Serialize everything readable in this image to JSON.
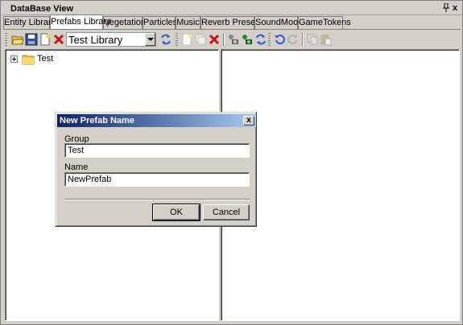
{
  "window": {
    "title": "DataBase View",
    "pin_icon": "pin-icon",
    "close_glyph": "x"
  },
  "tabs": [
    {
      "label": "Entity Library",
      "active": false
    },
    {
      "label": "Prefabs Library",
      "active": true
    },
    {
      "label": "Vegetation",
      "active": false
    },
    {
      "label": "Particles",
      "active": false
    },
    {
      "label": "Music",
      "active": false
    },
    {
      "label": "Reverb Presets",
      "active": false
    },
    {
      "label": "SoundMoods",
      "active": false
    },
    {
      "label": "GameTokens",
      "active": false
    }
  ],
  "toolbar": {
    "library_select": "Test Library",
    "icons": [
      "open-icon",
      "save-icon",
      "new-library-icon",
      "delete-library-icon",
      "reload-icon",
      "add-item-icon",
      "clone-icon",
      "remove-item-icon",
      "assign-icon",
      "get-properties-icon",
      "reload-items-icon",
      "undo-icon",
      "redo-icon",
      "copy-icon",
      "paste-icon"
    ]
  },
  "tree": {
    "items": [
      {
        "label": "Test",
        "expandable": true
      }
    ]
  },
  "dialog": {
    "title": "New Prefab Name",
    "close_glyph": "x",
    "group_label": "Group",
    "group_value": "Test",
    "name_label": "Name",
    "name_value": "NewPrefab",
    "ok_label": "OK",
    "cancel_label": "Cancel"
  },
  "colors": {
    "chrome": "#d4d0c8",
    "title_gradient_start": "#0a246a",
    "title_gradient_end": "#a6caf0"
  }
}
